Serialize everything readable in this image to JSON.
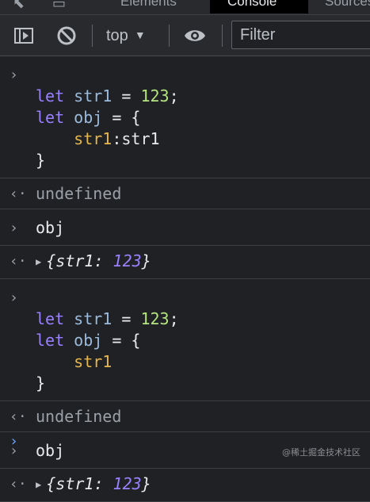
{
  "tabs": [
    {
      "label": "Elements",
      "active": false
    },
    {
      "label": "Console",
      "active": true
    },
    {
      "label": "Sources",
      "active": false
    }
  ],
  "toolbar": {
    "context": "top",
    "filter_placeholder": "Filter"
  },
  "entries": [
    {
      "kind": "input",
      "lines": [
        {
          "indent": "",
          "tokens": [
            [
              "kw",
              "let"
            ],
            [
              "punc",
              " "
            ],
            [
              "var",
              "str1"
            ],
            [
              "punc",
              " = "
            ],
            [
              "num",
              "123"
            ],
            [
              "punc",
              ";"
            ]
          ]
        },
        {
          "indent": "",
          "tokens": [
            [
              "kw",
              "let"
            ],
            [
              "punc",
              " "
            ],
            [
              "var",
              "obj"
            ],
            [
              "punc",
              " = {"
            ]
          ]
        },
        {
          "indent": "    ",
          "tokens": [
            [
              "prop",
              "str1"
            ],
            [
              "punc",
              ":str1"
            ]
          ]
        },
        {
          "indent": "",
          "tokens": [
            [
              "punc",
              "}"
            ]
          ]
        }
      ]
    },
    {
      "kind": "output",
      "text": "undefined"
    },
    {
      "kind": "input",
      "lines": [
        {
          "indent": "",
          "tokens": [
            [
              "punc",
              "obj"
            ]
          ]
        }
      ]
    },
    {
      "kind": "output-object",
      "key": "str1",
      "value": "123"
    },
    {
      "kind": "input",
      "lines": [
        {
          "indent": "",
          "tokens": [
            [
              "kw",
              "let"
            ],
            [
              "punc",
              " "
            ],
            [
              "var",
              "str1"
            ],
            [
              "punc",
              " = "
            ],
            [
              "num",
              "123"
            ],
            [
              "punc",
              ";"
            ]
          ]
        },
        {
          "indent": "",
          "tokens": [
            [
              "kw",
              "let"
            ],
            [
              "punc",
              " "
            ],
            [
              "var",
              "obj"
            ],
            [
              "punc",
              " = {"
            ]
          ]
        },
        {
          "indent": "    ",
          "tokens": [
            [
              "prop",
              "str1"
            ]
          ]
        },
        {
          "indent": "",
          "tokens": [
            [
              "punc",
              "}"
            ]
          ]
        }
      ]
    },
    {
      "kind": "output",
      "text": "undefined"
    },
    {
      "kind": "input",
      "lines": [
        {
          "indent": "",
          "tokens": [
            [
              "punc",
              "obj"
            ]
          ]
        }
      ]
    },
    {
      "kind": "output-object",
      "key": "str1",
      "value": "123"
    }
  ],
  "watermark": "@稀土掘金技术社区",
  "colors": {
    "background": "#202124",
    "keyword": "#9980ff",
    "number": "#b4e47f",
    "property": "#e5b64c",
    "prompt": "#6ea6ff"
  }
}
